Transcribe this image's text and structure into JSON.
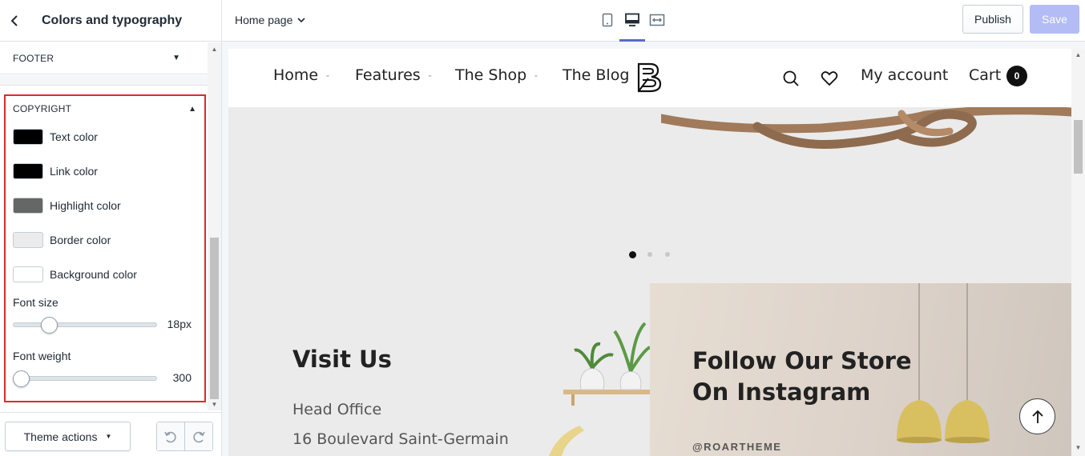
{
  "sidebar": {
    "title": "Colors and typography",
    "footer_section": "FOOTER",
    "copyright_section": "COPYRIGHT",
    "colors": [
      {
        "label": "Text color",
        "value": "#000000"
      },
      {
        "label": "Link color",
        "value": "#000000"
      },
      {
        "label": "Highlight color",
        "value": "#666666"
      },
      {
        "label": "Border color",
        "value": "#ebebeb"
      },
      {
        "label": "Background color",
        "value": "#ffffff"
      }
    ],
    "font_size": {
      "label": "Font size",
      "value": "18px",
      "level": 0.22
    },
    "font_weight": {
      "label": "Font weight",
      "value": "300",
      "level": 0.0
    },
    "theme_actions": "Theme actions"
  },
  "topbar": {
    "page_select": "Home page",
    "publish": "Publish",
    "save": "Save",
    "active_device": "desktop"
  },
  "preview": {
    "nav": {
      "items": [
        "Home",
        "Features",
        "The Shop",
        "The Blog"
      ],
      "account": "My account",
      "cart": "Cart",
      "cart_count": "0"
    },
    "visit": {
      "title": "Visit Us",
      "line1": "Head Office",
      "line2": "16 Boulevard Saint-Germain"
    },
    "instagram": {
      "title": "Follow Our Store On Instagram",
      "handle": "@ROARTHEME"
    },
    "slides": 3,
    "active_slide": 0
  },
  "colors": {
    "accent": "#5c6ac4",
    "highlight_border": "#d82c2c",
    "save_disabled": "#b3bcf5"
  }
}
